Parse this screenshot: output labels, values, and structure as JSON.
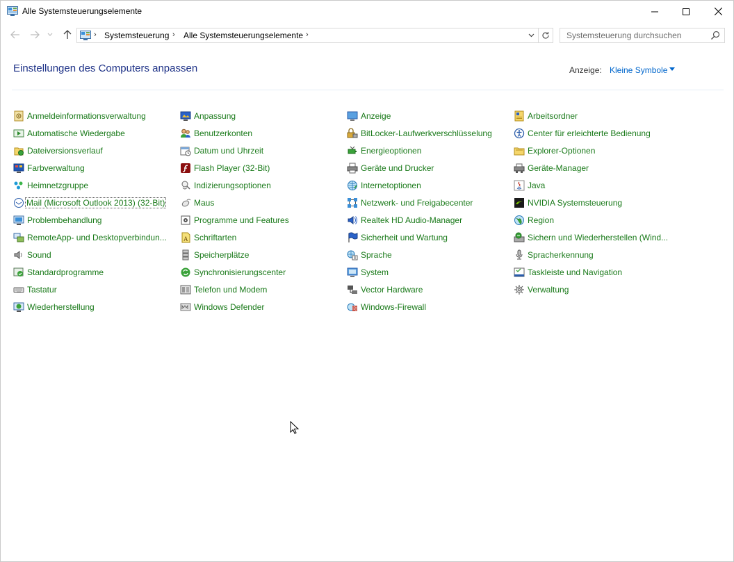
{
  "window": {
    "title": "Alle Systemsteuerungselemente"
  },
  "address": {
    "crumbs": [
      "Systemsteuerung",
      "Alle Systemsteuerungselemente"
    ]
  },
  "search": {
    "placeholder": "Systemsteuerung durchsuchen"
  },
  "header": {
    "title": "Einstellungen des Computers anpassen",
    "view_label": "Anzeige:",
    "view_value": "Kleine Symbole"
  },
  "columns": [
    {
      "items": [
        {
          "label": "Anmeldeinformationsverwaltung",
          "icon": "credential-vault-icon"
        },
        {
          "label": "Automatische Wiedergabe",
          "icon": "autoplay-icon"
        },
        {
          "label": "Dateiversionsverlauf",
          "icon": "file-history-icon"
        },
        {
          "label": "Farbverwaltung",
          "icon": "color-management-icon"
        },
        {
          "label": "Heimnetzgruppe",
          "icon": "homegroup-icon"
        },
        {
          "label": "Mail (Microsoft Outlook 2013) (32-Bit)",
          "icon": "mail-icon"
        },
        {
          "label": "Problembehandlung",
          "icon": "troubleshooting-icon"
        },
        {
          "label": "RemoteApp- und Desktopverbindun...",
          "icon": "remoteapp-icon"
        },
        {
          "label": "Sound",
          "icon": "speaker-icon"
        },
        {
          "label": "Standardprogramme",
          "icon": "default-programs-icon"
        },
        {
          "label": "Tastatur",
          "icon": "keyboard-icon"
        },
        {
          "label": "Wiederherstellung",
          "icon": "recovery-icon"
        }
      ]
    },
    {
      "items": [
        {
          "label": "Anpassung",
          "icon": "personalization-icon"
        },
        {
          "label": "Benutzerkonten",
          "icon": "user-accounts-icon"
        },
        {
          "label": "Datum und Uhrzeit",
          "icon": "date-time-icon"
        },
        {
          "label": "Flash Player (32-Bit)",
          "icon": "flash-player-icon"
        },
        {
          "label": "Indizierungsoptionen",
          "icon": "indexing-icon"
        },
        {
          "label": "Maus",
          "icon": "mouse-icon"
        },
        {
          "label": "Programme und Features",
          "icon": "programs-features-icon"
        },
        {
          "label": "Schriftarten",
          "icon": "fonts-icon"
        },
        {
          "label": "Speicherplätze",
          "icon": "storage-spaces-icon"
        },
        {
          "label": "Synchronisierungscenter",
          "icon": "sync-center-icon"
        },
        {
          "label": "Telefon und Modem",
          "icon": "phone-modem-icon"
        },
        {
          "label": "Windows Defender",
          "icon": "windows-defender-icon"
        }
      ]
    },
    {
      "items": [
        {
          "label": "Anzeige",
          "icon": "display-icon"
        },
        {
          "label": "BitLocker-Laufwerkverschlüsselung",
          "icon": "bitlocker-icon"
        },
        {
          "label": "Energieoptionen",
          "icon": "power-options-icon"
        },
        {
          "label": "Geräte und Drucker",
          "icon": "printer-icon"
        },
        {
          "label": "Internetoptionen",
          "icon": "internet-options-icon"
        },
        {
          "label": "Netzwerk- und Freigabecenter",
          "icon": "network-icon"
        },
        {
          "label": "Realtek HD Audio-Manager",
          "icon": "realtek-audio-icon"
        },
        {
          "label": "Sicherheit und Wartung",
          "icon": "security-flag-icon"
        },
        {
          "label": "Sprache",
          "icon": "language-icon"
        },
        {
          "label": "System",
          "icon": "system-icon"
        },
        {
          "label": "Vector Hardware",
          "icon": "vector-hardware-icon"
        },
        {
          "label": "Windows-Firewall",
          "icon": "firewall-icon"
        }
      ]
    },
    {
      "items": [
        {
          "label": "Arbeitsordner",
          "icon": "work-folders-icon"
        },
        {
          "label": "Center für erleichterte Bedienung",
          "icon": "ease-of-access-icon"
        },
        {
          "label": "Explorer-Optionen",
          "icon": "explorer-options-icon"
        },
        {
          "label": "Geräte-Manager",
          "icon": "device-manager-icon"
        },
        {
          "label": "Java",
          "icon": "java-icon"
        },
        {
          "label": "NVIDIA Systemsteuerung",
          "icon": "nvidia-icon"
        },
        {
          "label": "Region",
          "icon": "region-icon"
        },
        {
          "label": "Sichern und Wiederherstellen (Wind...",
          "icon": "backup-restore-icon"
        },
        {
          "label": "Spracherkennung",
          "icon": "microphone-icon"
        },
        {
          "label": "Taskleiste und Navigation",
          "icon": "taskbar-icon"
        },
        {
          "label": "Verwaltung",
          "icon": "administrative-tools-icon"
        }
      ]
    }
  ]
}
